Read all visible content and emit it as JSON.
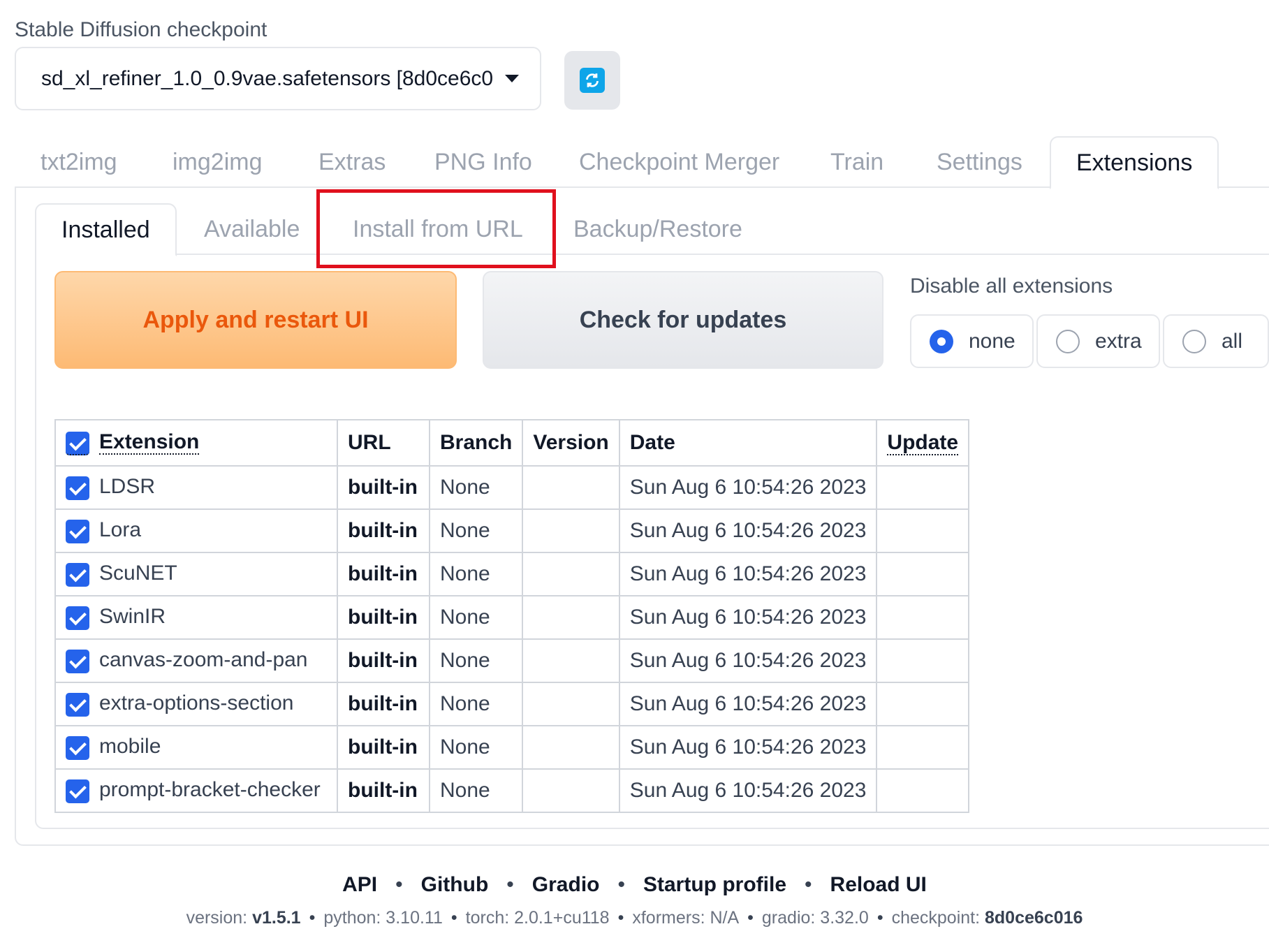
{
  "checkpoint": {
    "label": "Stable Diffusion checkpoint",
    "value": "sd_xl_refiner_1.0_0.9vae.safetensors [8d0ce6c0",
    "refresh_icon": "refresh-icon"
  },
  "main_tabs": [
    "txt2img",
    "img2img",
    "Extras",
    "PNG Info",
    "Checkpoint Merger",
    "Train",
    "Settings",
    "Extensions"
  ],
  "sub_tabs": [
    "Installed",
    "Available",
    "Install from URL",
    "Backup/Restore"
  ],
  "buttons": {
    "apply": "Apply and restart UI",
    "check": "Check for updates"
  },
  "disable": {
    "label": "Disable all extensions",
    "options": [
      "none",
      "extra",
      "all"
    ],
    "selected": "none"
  },
  "table": {
    "headers": [
      "Extension",
      "URL",
      "Branch",
      "Version",
      "Date",
      "Update"
    ],
    "rows": [
      {
        "name": "LDSR",
        "url": "built-in",
        "branch": "None",
        "version": "",
        "date": "Sun Aug 6 10:54:26 2023",
        "update": ""
      },
      {
        "name": "Lora",
        "url": "built-in",
        "branch": "None",
        "version": "",
        "date": "Sun Aug 6 10:54:26 2023",
        "update": ""
      },
      {
        "name": "ScuNET",
        "url": "built-in",
        "branch": "None",
        "version": "",
        "date": "Sun Aug 6 10:54:26 2023",
        "update": ""
      },
      {
        "name": "SwinIR",
        "url": "built-in",
        "branch": "None",
        "version": "",
        "date": "Sun Aug 6 10:54:26 2023",
        "update": ""
      },
      {
        "name": "canvas-zoom-and-pan",
        "url": "built-in",
        "branch": "None",
        "version": "",
        "date": "Sun Aug 6 10:54:26 2023",
        "update": ""
      },
      {
        "name": "extra-options-section",
        "url": "built-in",
        "branch": "None",
        "version": "",
        "date": "Sun Aug 6 10:54:26 2023",
        "update": ""
      },
      {
        "name": "mobile",
        "url": "built-in",
        "branch": "None",
        "version": "",
        "date": "Sun Aug 6 10:54:26 2023",
        "update": ""
      },
      {
        "name": "prompt-bracket-checker",
        "url": "built-in",
        "branch": "None",
        "version": "",
        "date": "Sun Aug 6 10:54:26 2023",
        "update": ""
      }
    ]
  },
  "footer": {
    "links": [
      "API",
      "Github",
      "Gradio",
      "Startup profile",
      "Reload UI"
    ],
    "info": {
      "version_label": "version:",
      "version": "v1.5.1",
      "python": "python: 3.10.11",
      "torch": "torch: 2.0.1+cu118",
      "xformers": "xformers: N/A",
      "gradio": "gradio: 3.32.0",
      "checkpoint_label": "checkpoint:",
      "checkpoint": "8d0ce6c016"
    }
  },
  "colors": {
    "accent_blue": "#2563eb",
    "apply_text": "#ea580c",
    "highlight_red": "#e0101d"
  }
}
